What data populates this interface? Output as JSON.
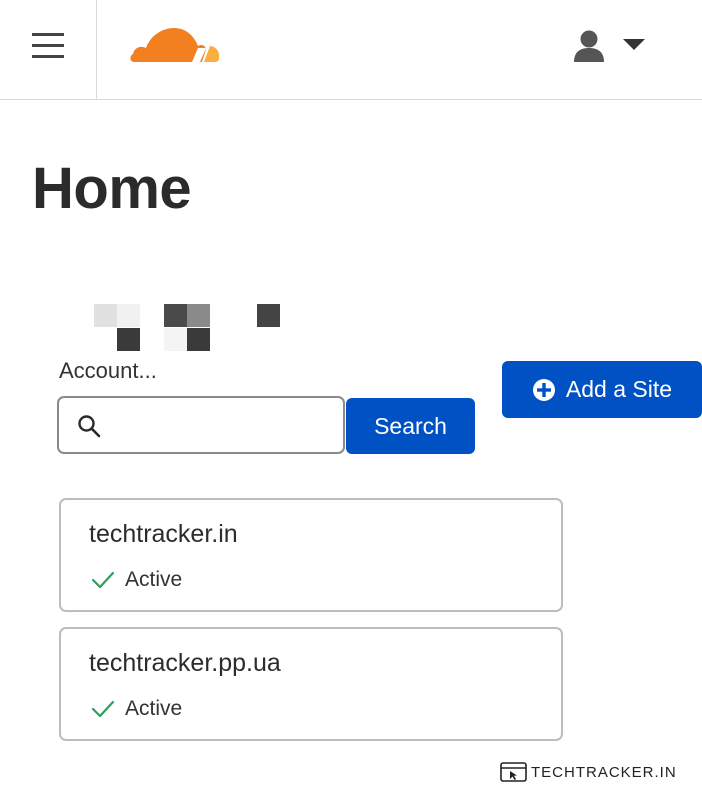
{
  "header": {
    "menu_icon": "hamburger-menu-icon",
    "logo_icon": "cloudflare-cloud-logo",
    "user_icon": "user-icon",
    "dropdown_icon": "caret-down-icon",
    "logo_colors": {
      "primary": "#f38020",
      "secondary": "#faae40"
    }
  },
  "page": {
    "title": "Home"
  },
  "account": {
    "label": "Account..."
  },
  "actions": {
    "add_site_label": "Add a Site",
    "add_icon": "plus-circle-icon"
  },
  "search": {
    "placeholder": "",
    "value": "",
    "button_label": "Search",
    "icon": "search-icon"
  },
  "sites": [
    {
      "domain": "techtracker.in",
      "status": "Active",
      "status_icon": "check-icon"
    },
    {
      "domain": "techtracker.pp.ua",
      "status": "Active",
      "status_icon": "check-icon"
    }
  ],
  "watermark": {
    "text": "TECHTRACKER.IN"
  },
  "colors": {
    "accent": "#0051c3",
    "active_check": "#2e9e5c",
    "border": "#bdbdbd"
  }
}
